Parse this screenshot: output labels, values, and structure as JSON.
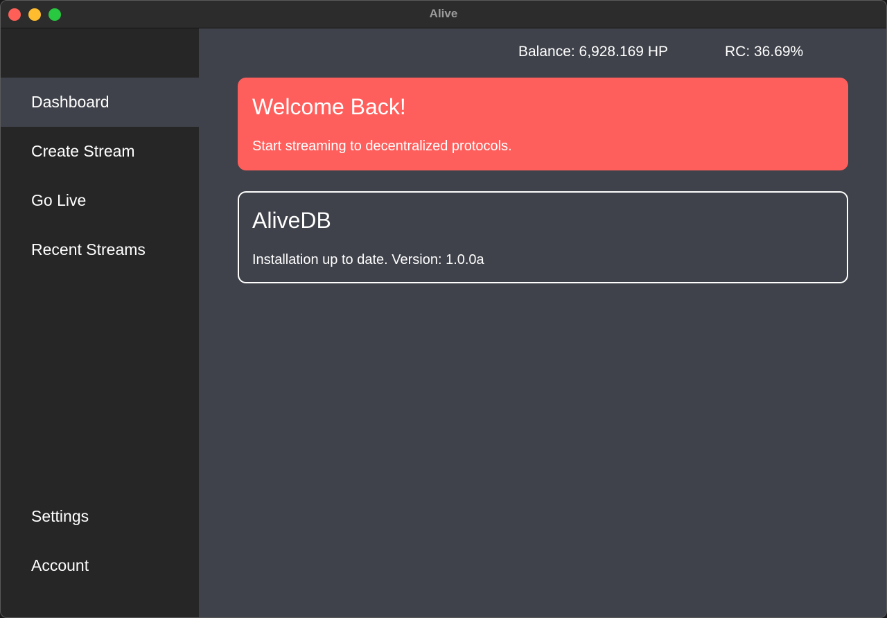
{
  "window": {
    "title": "Alive"
  },
  "sidebar": {
    "items": [
      {
        "label": "Dashboard",
        "active": true
      },
      {
        "label": "Create Stream",
        "active": false
      },
      {
        "label": "Go Live",
        "active": false
      },
      {
        "label": "Recent Streams",
        "active": false
      },
      {
        "label": "Settings",
        "active": false
      },
      {
        "label": "Account",
        "active": false
      }
    ]
  },
  "header": {
    "balance": "Balance: 6,928.169 HP",
    "rc": "RC: 36.69%"
  },
  "welcome_card": {
    "title": "Welcome Back!",
    "text": "Start streaming to decentralized protocols."
  },
  "alivedb_card": {
    "title": "AliveDB",
    "text": "Installation up to date. Version: 1.0.0a"
  },
  "colors": {
    "accent": "#ff5f5c",
    "sidebar_bg": "#262626",
    "main_bg": "#3f424a",
    "titlebar_bg": "#2c2c2c"
  }
}
